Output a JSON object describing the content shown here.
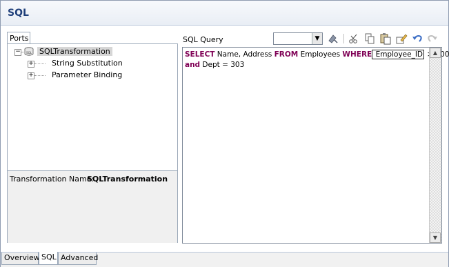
{
  "header": {
    "title": "SQL"
  },
  "ports_tab": {
    "label": "Ports"
  },
  "tree": {
    "root": {
      "label": "SQLTransformation",
      "icon": "database-icon"
    },
    "children": [
      {
        "label": "String Substitution"
      },
      {
        "label": "Parameter Binding"
      }
    ]
  },
  "info": {
    "name_label": "Transformation Name:",
    "name_value": "SQLTransformation"
  },
  "editor": {
    "label": "SQL Query",
    "combo_value": "",
    "line1": {
      "kw1": "SELECT",
      "t1": " Name, Address ",
      "kw2": "FROM",
      "t2": " Employees ",
      "kw3": "WHERE",
      "t3": " Employee_ID",
      "t4": " > 100"
    },
    "line2": {
      "kw1": "and",
      "t1": " Dept = 303"
    }
  },
  "toolbar": {
    "icons": [
      "format-icon",
      "cut-icon",
      "copy-icon",
      "paste-icon",
      "edit-icon",
      "undo-icon",
      "redo-icon"
    ]
  },
  "bottom_tabs": [
    {
      "label": "Overview",
      "active": false
    },
    {
      "label": "SQL",
      "active": true
    },
    {
      "label": "Advanced",
      "active": false
    }
  ],
  "colors": {
    "keyword": "#7f0055",
    "title": "#1f3f7a"
  }
}
